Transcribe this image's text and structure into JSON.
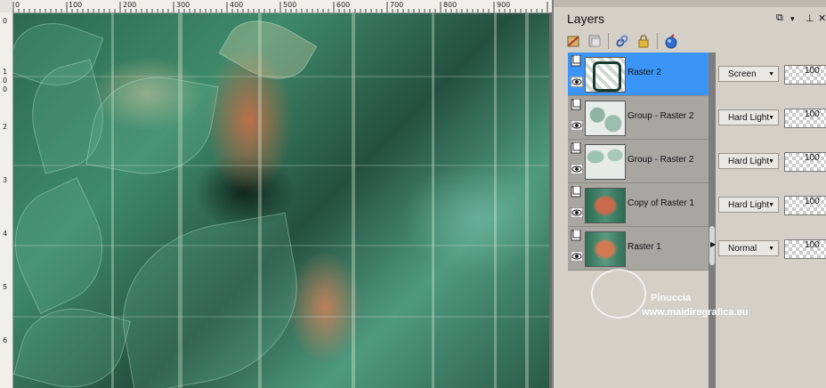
{
  "ruler": {
    "top_labels": [
      "0",
      "100",
      "200",
      "300",
      "400",
      "500",
      "600",
      "700",
      "800",
      "900"
    ],
    "left_labels": [
      "0",
      "1",
      "2",
      "3",
      "4",
      "5",
      "6"
    ],
    "left_sublabels": [
      "0",
      "0"
    ]
  },
  "panel": {
    "title": "Layers",
    "title_buttons": [
      "⧉",
      "▾",
      "⊥",
      "✕"
    ]
  },
  "layers": [
    {
      "name": "Raster 2",
      "blend": "Screen",
      "opacity": "100",
      "selected": true
    },
    {
      "name": "Group - Raster 2",
      "blend": "Hard Light",
      "opacity": "100",
      "selected": false
    },
    {
      "name": "Group - Raster 2",
      "blend": "Hard Light",
      "opacity": "100",
      "selected": false
    },
    {
      "name": "Copy of Raster 1",
      "blend": "Hard Light",
      "opacity": "100",
      "selected": false
    },
    {
      "name": "Raster 1",
      "blend": "Normal",
      "opacity": "100",
      "selected": false
    }
  ],
  "watermark": {
    "name": "Pinuccia",
    "url": "www.maidiregrafica.eu"
  },
  "colors": {
    "selection": "#3b95f6",
    "layer_bg": "#a7a6a1",
    "panel_bg": "#d4d0c8"
  }
}
